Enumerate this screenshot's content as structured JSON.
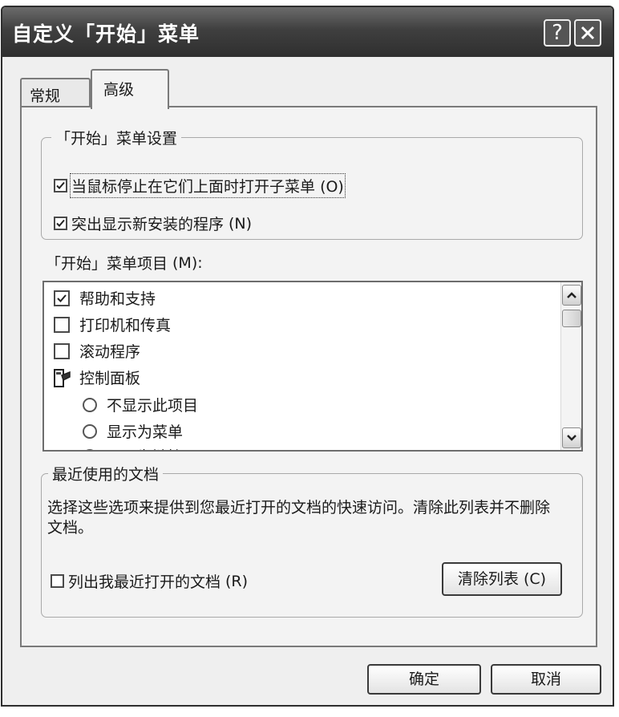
{
  "window": {
    "title": "自定义「开始」菜单",
    "help_glyph": "?"
  },
  "tabs": [
    {
      "label": "常规",
      "active": false
    },
    {
      "label": "高级",
      "active": true
    }
  ],
  "start_menu_settings": {
    "title": "「开始」菜单设置",
    "options": [
      {
        "label": "当鼠标停止在它们上面时打开子菜单",
        "accel": "(O)",
        "checked": true
      },
      {
        "label": "突出显示新安装的程序",
        "accel": "(N)",
        "checked": true
      }
    ]
  },
  "start_menu_items": {
    "label": "「开始」菜单项目",
    "accel": "(M):",
    "items": [
      {
        "type": "checkbox",
        "label": "帮助和支持",
        "checked": true
      },
      {
        "type": "checkbox",
        "label": "打印机和传真",
        "checked": false
      },
      {
        "type": "checkbox",
        "label": "滚动程序",
        "checked": false
      },
      {
        "type": "group",
        "label": "控制面板",
        "icon": "control-panel-icon"
      },
      {
        "type": "radio",
        "label": "不显示此项目",
        "selected": false
      },
      {
        "type": "radio",
        "label": "显示为菜单",
        "selected": false
      },
      {
        "type": "radio",
        "label": "显示为链接",
        "selected": true
      }
    ]
  },
  "recent_documents": {
    "title": "最近使用的文档",
    "description": "选择这些选项来提供到您最近打开的文档的快速访问。清除此列表并不删除文档。",
    "list_option": {
      "label": "列出我最近打开的文档",
      "accel": "(R)",
      "checked": false
    },
    "clear_button": "清除列表 (C)"
  },
  "footer": {
    "ok": "确定",
    "cancel": "取消"
  }
}
